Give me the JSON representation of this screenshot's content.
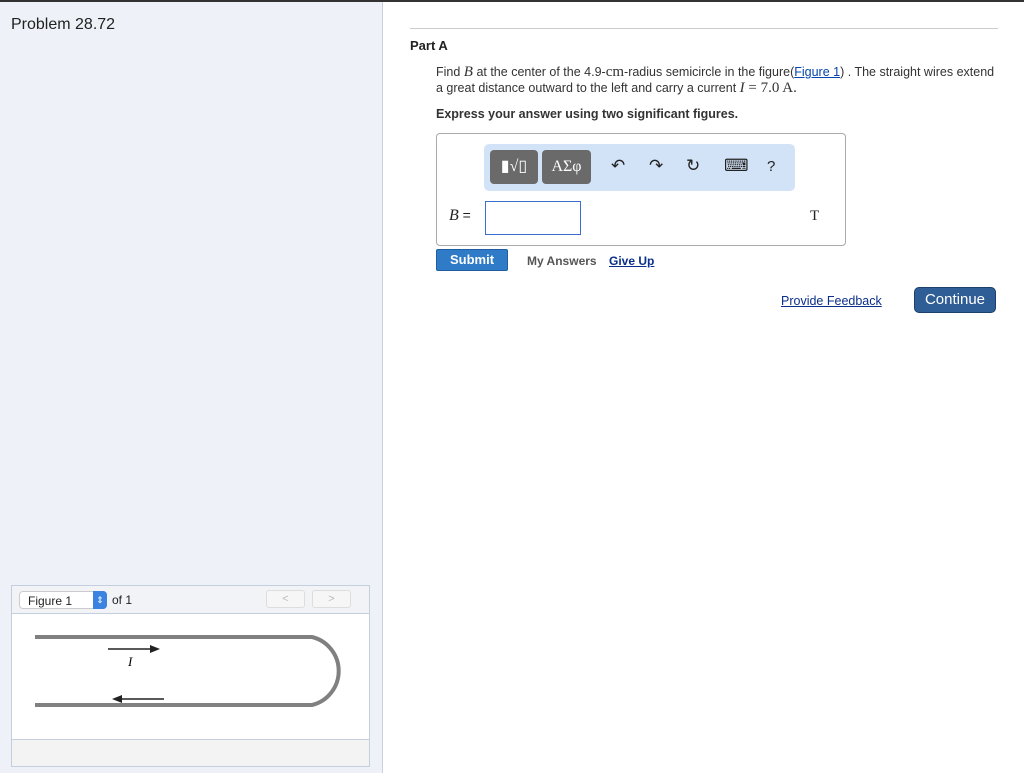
{
  "problem_title": "Problem 28.72",
  "figure_panel": {
    "selected": "Figure 1",
    "of_label": "of 1",
    "prev": "<",
    "next": ">",
    "current_label": "I"
  },
  "part": {
    "title": "Part A",
    "q_find": "Find ",
    "q_B": "B",
    "q_mid": " at the center of the 4.9-",
    "q_cm": "cm",
    "q_mid2": "-radius semicircle in the figure(",
    "q_link": "Figure 1",
    "q_end": ") . The straight wires extend a great distance outward to the left and carry a current ",
    "q_I": "I",
    "q_eq": " = 7.0 A",
    ".": ".",
    "q_period": ".",
    "instruction": "Express your answer using two significant figures."
  },
  "answer": {
    "variable": "B",
    "equals": " =",
    "value": "",
    "unit": "T",
    "toolbar": {
      "templates": "▮√▯",
      "greek": "ΑΣφ",
      "undo": "↶",
      "redo": "↷",
      "reset": "↻",
      "keyboard": "⌨",
      "help": "?"
    }
  },
  "actions": {
    "submit": "Submit",
    "my_answers": "My Answers",
    "give_up": "Give Up",
    "feedback": "Provide Feedback",
    "continue": "Continue"
  }
}
